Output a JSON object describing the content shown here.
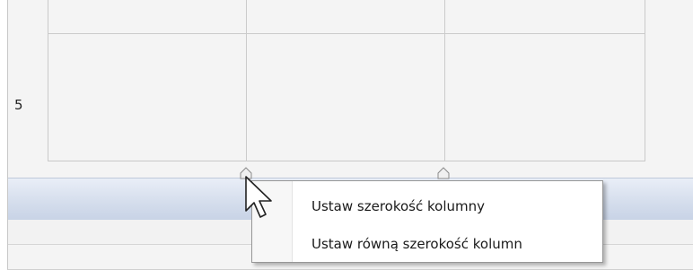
{
  "table": {
    "row_label": "5"
  },
  "context_menu": {
    "items": [
      {
        "label": "Ustaw szerokość kolumny"
      },
      {
        "label": "Ustaw równą szerokość kolumn"
      }
    ]
  }
}
